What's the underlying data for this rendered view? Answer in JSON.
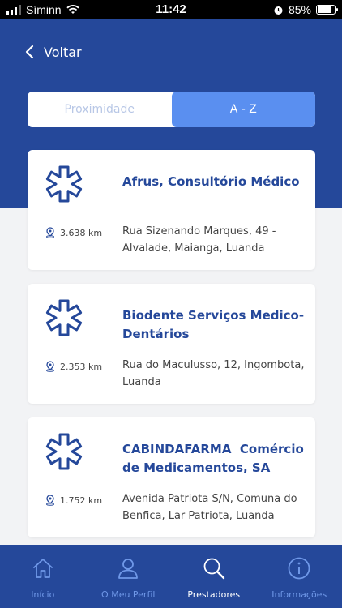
{
  "status_bar": {
    "carrier": "Síminn",
    "time": "11:42",
    "battery": "85%",
    "battery_level": 0.85
  },
  "header": {
    "back_label": "Voltar"
  },
  "sort_tabs": [
    {
      "label": "Proximidade",
      "active": false
    },
    {
      "label": "A - Z",
      "active": true
    }
  ],
  "providers": [
    {
      "name": "Afrus, Consultório Médico",
      "distance": "3.638 km",
      "address": "Rua Sizenando Marques, 49 - Alvalade, Maianga, Luanda"
    },
    {
      "name": "Biodente Serviços Medico-Dentários",
      "distance": "2.353 km",
      "address": "Rua do Maculusso, 12, Ingombota, Luanda"
    },
    {
      "name": "CABINDAFARMA  Comércio de Medicamentos, SA",
      "distance": "1.752 km",
      "address": "Avenida Patriota S/N, Comuna do Benfica, Lar Patriota, Luanda"
    }
  ],
  "bottom_nav": [
    {
      "label": "Início",
      "icon": "home-icon",
      "active": false
    },
    {
      "label": "O Meu Perfil",
      "icon": "user-icon",
      "active": false
    },
    {
      "label": "Prestadores",
      "icon": "search-icon",
      "active": true
    },
    {
      "label": "Informações",
      "icon": "info-icon",
      "active": false
    }
  ],
  "colors": {
    "brand_blue": "#25489a",
    "accent_blue": "#5a8ff0",
    "nav_inactive": "#6f98e8"
  }
}
